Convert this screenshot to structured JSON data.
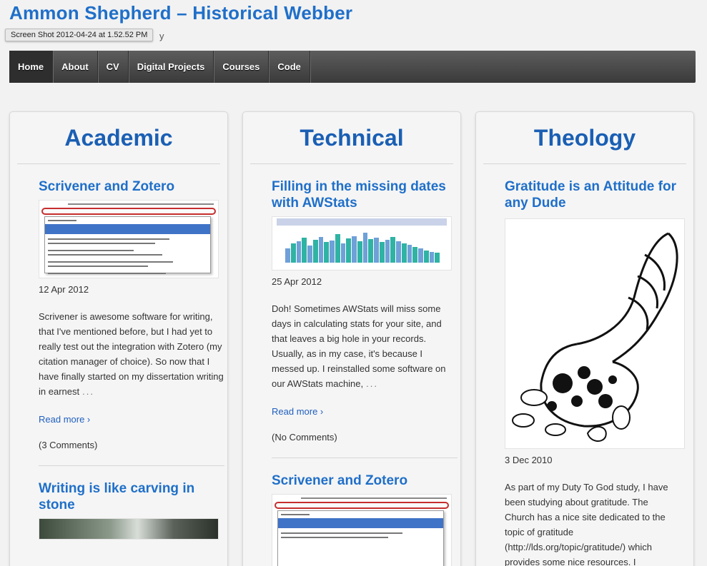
{
  "site": {
    "title": "Ammon Shepherd – Historical Webber",
    "tagline_visible": "y",
    "tooltip": "Screen Shot 2012-04-24 at 1.52.52 PM"
  },
  "nav": {
    "items": [
      "Home",
      "About",
      "CV",
      "Digital Projects",
      "Courses",
      "Code"
    ],
    "active": "Home"
  },
  "colors": {
    "title_blue": "#1f6fc9",
    "heading_blue": "#1a5fb4",
    "nav_bg": "#4a4a4a"
  },
  "columns": {
    "academic": {
      "heading": "Academic",
      "posts": [
        {
          "title": "Scrivener and Zotero",
          "image": "zotero-screenshot",
          "date": "12 Apr 2012",
          "excerpt": "Scrivener is awesome software for writing, that I've mentioned before, but I had yet to really test out the integration with Zotero (my citation manager of choice). So now that I have finally started on my dissertation writing in earnest",
          "ellipsis": "...",
          "read_more": "Read more ›",
          "comments": "(3 Comments)"
        },
        {
          "title": "Writing is like carving in stone",
          "image": "stone-photo"
        }
      ]
    },
    "technical": {
      "heading": "Technical",
      "posts": [
        {
          "title": "Filling in the missing dates with AWStats",
          "image": "awstats-chart",
          "date": "25 Apr 2012",
          "excerpt": "Doh! Sometimes AWStats will miss some days in calculating stats for your site, and that leaves a big hole in your records. Usually, as in my case, it's because I messed up. I reinstalled some software on our AWStats machine,",
          "ellipsis": "...",
          "read_more": "Read more ›",
          "comments": "(No Comments)"
        },
        {
          "title": "Scrivener and Zotero",
          "image": "zotero-screenshot"
        }
      ]
    },
    "theology": {
      "heading": "Theology",
      "posts": [
        {
          "title": "Gratitude is an Attitude for any Dude",
          "image": "cornucopia-drawing",
          "date": "3 Dec 2010",
          "excerpt": "As part of my Duty To God study, I have been studying about gratitude. The Church has a nice site dedicated to the topic of gratitude (http://lds.org/topic/gratitude/) which provides some nice resources. I"
        }
      ]
    }
  }
}
